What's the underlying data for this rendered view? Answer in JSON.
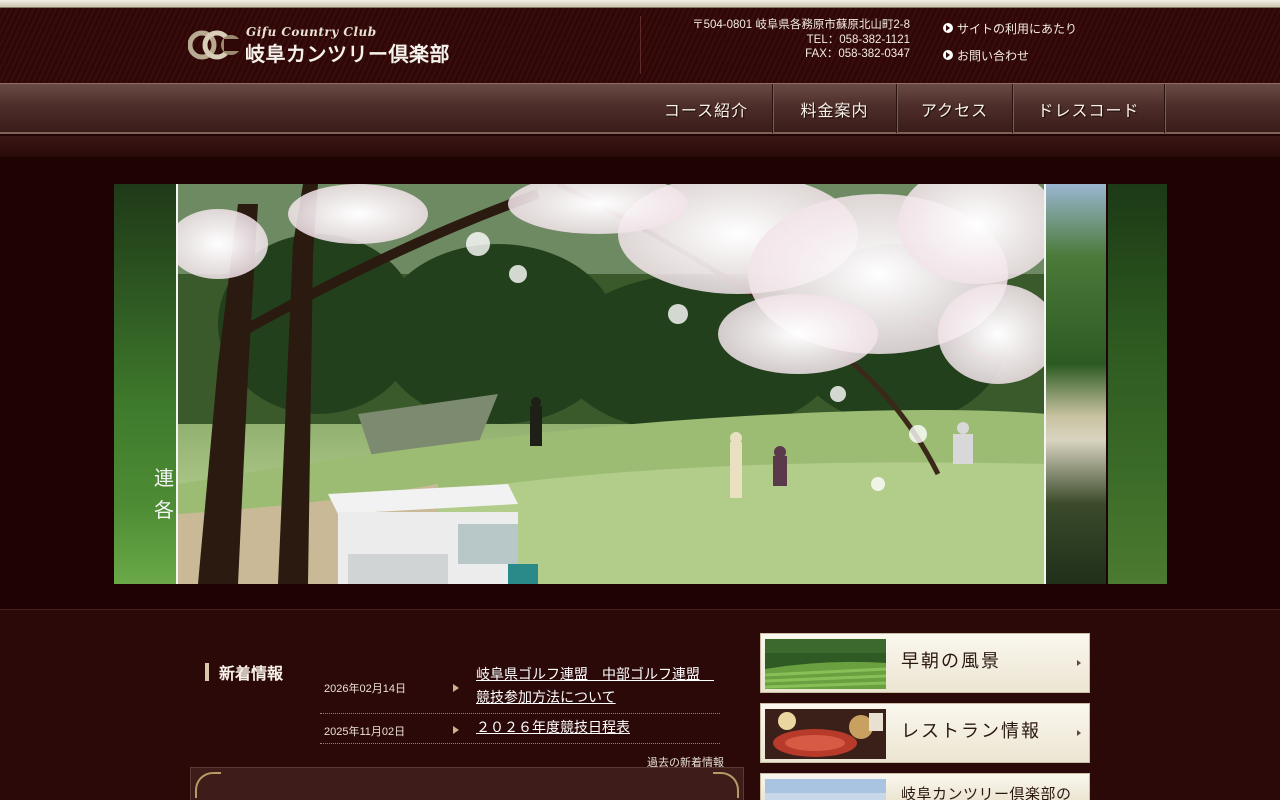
{
  "header": {
    "logo_en": "Gifu Country Club",
    "logo_jp": "岐阜カンツリー倶楽部",
    "address": "〒504-0801 岐阜県各務原市蘇原北山町2-8",
    "tel": "TEL：058-382-1121",
    "fax": "FAX：058-382-0347",
    "links": [
      "サイトの利用にあたり",
      "お問い合わせ"
    ]
  },
  "nav": {
    "items": [
      "コース紹介",
      "料金案内",
      "アクセス",
      "ドレスコード"
    ]
  },
  "hero": {
    "left_caption": "連各"
  },
  "news": {
    "title": "新着情報",
    "items": [
      {
        "date": "2026年02月14日",
        "title": "岐阜県ゴルフ連盟　中部ゴルフ連盟　競技参加方法について"
      },
      {
        "date": "2025年11月02日",
        "title": "２０２６年度競技日程表"
      }
    ],
    "more_label": "過去の新着情報"
  },
  "banners": [
    {
      "label": "早朝の風景",
      "icon": "fairway-thumbnail"
    },
    {
      "label": "レストラン情報",
      "icon": "restaurant-thumbnail"
    },
    {
      "label": "岐阜カンツリー倶楽部の",
      "icon": "clubhouse-thumbnail"
    }
  ],
  "colors": {
    "background": "#200404",
    "header": "#2e0707",
    "nav": "#4e2e2a",
    "accent": "#c9b48c"
  }
}
